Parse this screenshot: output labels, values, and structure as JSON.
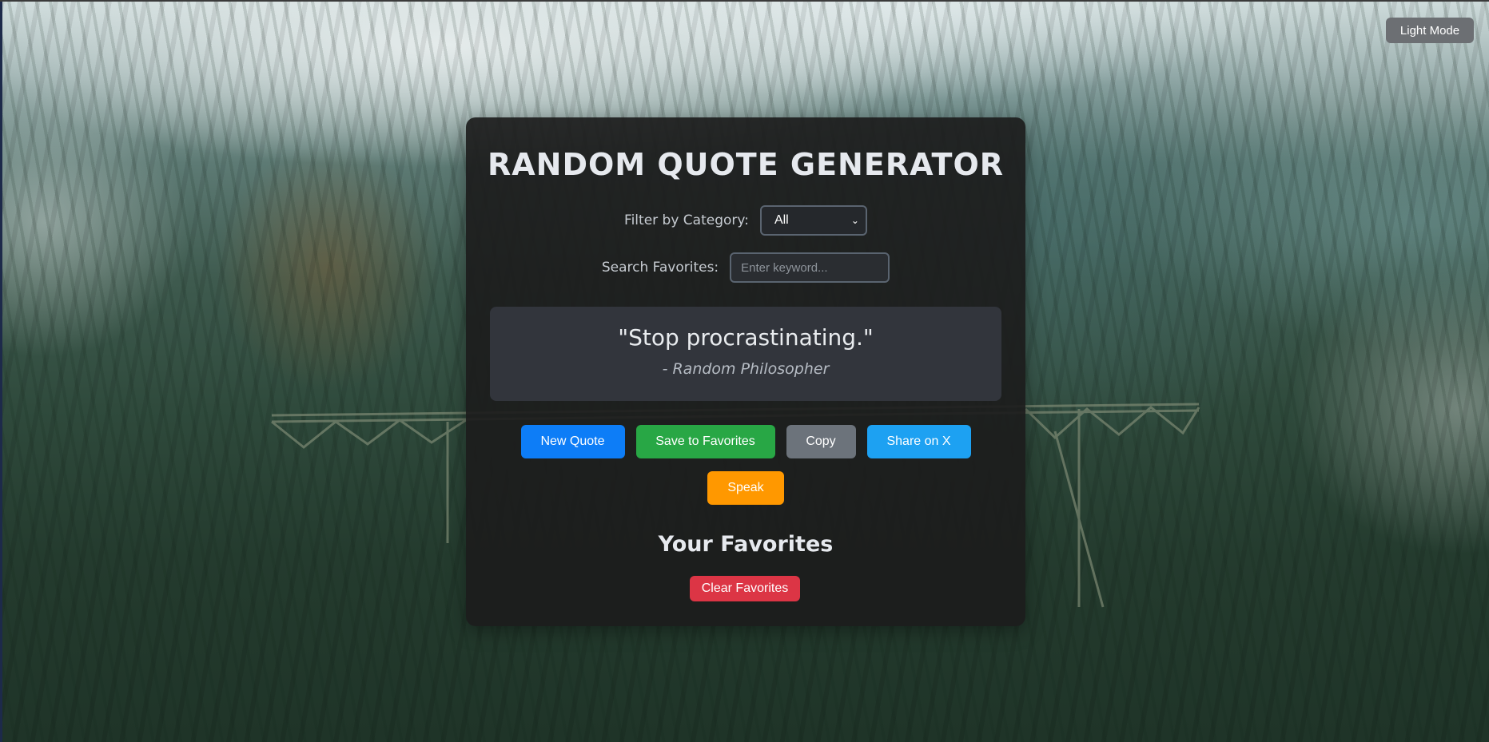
{
  "theme_toggle": {
    "label": "Light Mode"
  },
  "app": {
    "title": "RANDOM QUOTE GENERATOR"
  },
  "filter": {
    "label": "Filter by Category:",
    "selected": "All"
  },
  "search": {
    "label": "Search Favorites:",
    "placeholder": "Enter keyword...",
    "value": ""
  },
  "quote": {
    "text": "\"Stop procrastinating.\"",
    "author": "- Random Philosopher"
  },
  "actions": {
    "new_quote": "New Quote",
    "save": "Save to Favorites",
    "copy": "Copy",
    "share": "Share on X",
    "speak": "Speak"
  },
  "favorites": {
    "title": "Your Favorites",
    "clear_label": "Clear Favorites"
  },
  "colors": {
    "new_quote": "#0d7df7",
    "save": "#28a745",
    "copy": "#6c737b",
    "share": "#1da1f2",
    "speak": "#ff9800",
    "clear": "#dc3545",
    "toggle": "#6c6f73"
  },
  "icons": {
    "select_arrow": "chevron-down-icon"
  }
}
